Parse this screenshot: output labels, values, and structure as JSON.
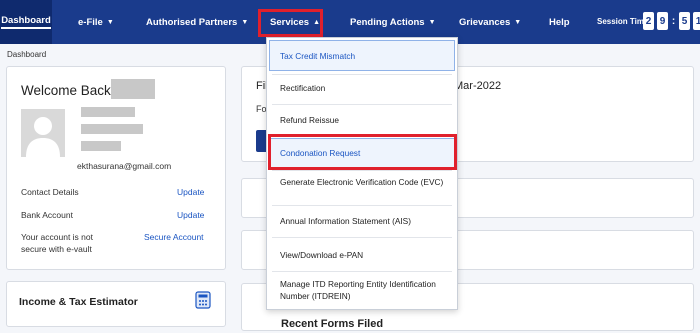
{
  "nav": {
    "dashboard": "Dashboard",
    "efile": "e-File",
    "authorised_partners": "Authorised Partners",
    "services": "Services",
    "pending_actions": "Pending Actions",
    "grievances": "Grievances",
    "help": "Help",
    "session_label": "Session Time",
    "session_digits": [
      "2",
      "9",
      ":",
      "5",
      "1"
    ]
  },
  "breadcrumb": "Dashboard",
  "welcome": {
    "title": "Welcome Back,",
    "email": "ekthasurana@gmail.com",
    "contact_label": "Contact Details",
    "contact_action": "Update",
    "bank_label": "Bank Account",
    "bank_action": "Update",
    "vault_line1": "Your account is not",
    "vault_line2": "secure with e-vault",
    "vault_action": "Secure Account"
  },
  "income_card": {
    "title": "Income & Tax Estimator"
  },
  "main_panel": {
    "frag_left": "Fil",
    "frag_right": "Mar-2022",
    "frag_sub": "Fo"
  },
  "recent_forms": "Recent Forms Filed",
  "services_menu": {
    "items": [
      {
        "label": "Tax Credit Mismatch"
      },
      {
        "label": "Rectification"
      },
      {
        "label": "Refund Reissue"
      },
      {
        "label": "Condonation Request"
      },
      {
        "label": "Generate Electronic Verification Code (EVC)"
      },
      {
        "label": "Annual Information Statement (AIS)"
      },
      {
        "label": "View/Download e-PAN"
      },
      {
        "label": "Manage ITD Reporting Entity Identification Number (ITDREIN)"
      }
    ]
  },
  "colors": {
    "nav_bg": "#1a3b8c",
    "highlight": "#e0202c",
    "link": "#1a55c2"
  }
}
